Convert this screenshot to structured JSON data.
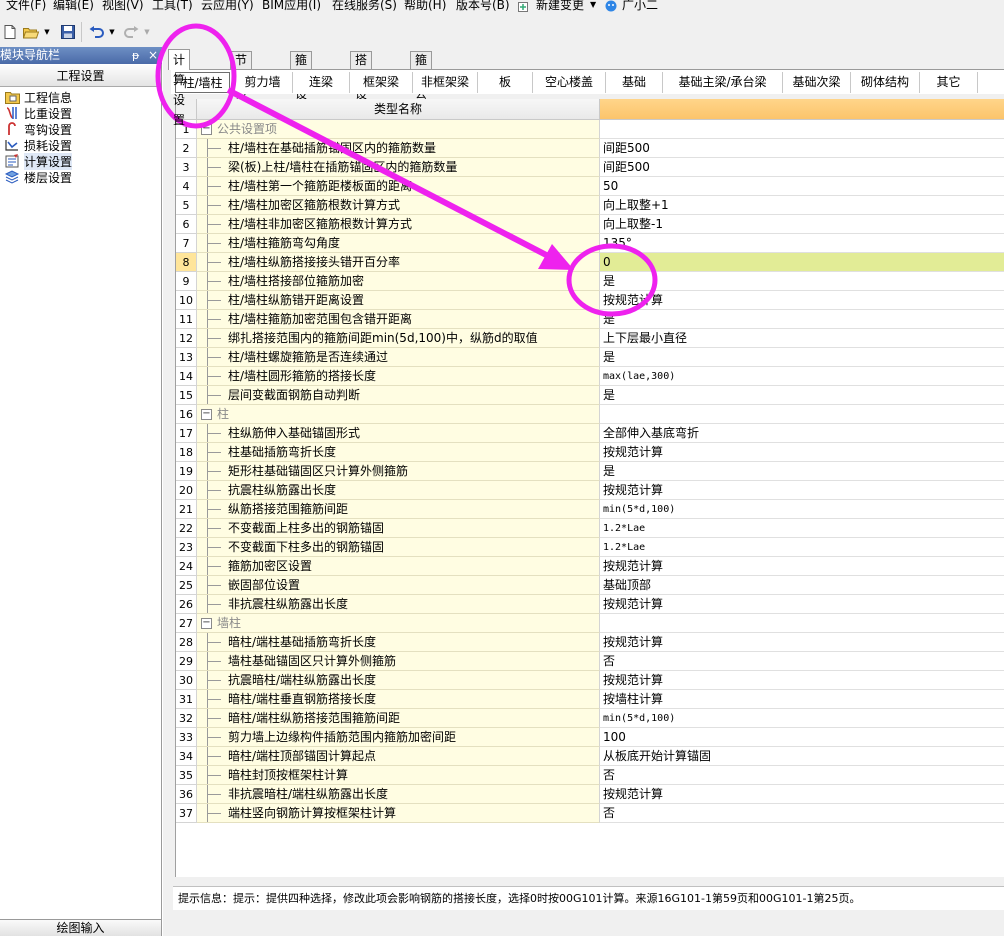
{
  "menubar": {
    "items": [
      "文件(F)",
      "编辑(E)",
      "视图(V)",
      "工具(T)",
      "云应用(Y)",
      "BIM应用(I)",
      "在线服务(S)",
      "帮助(H)",
      "版本号(B)",
      "新建变更",
      "广小二"
    ]
  },
  "toolbar": {
    "icons": [
      "new-file-icon",
      "open-folder-icon",
      "save-icon",
      "undo-icon",
      "redo-icon"
    ]
  },
  "left_panel": {
    "title": "模块导航栏",
    "pin": "ᵽ",
    "close": "×",
    "header": "工程设置",
    "items": [
      {
        "label": "工程信息",
        "icon": "project-info-icon"
      },
      {
        "label": "比重设置",
        "icon": "density-icon"
      },
      {
        "label": "弯钩设置",
        "icon": "hook-icon"
      },
      {
        "label": "损耗设置",
        "icon": "loss-icon"
      },
      {
        "label": "计算设置",
        "icon": "calc-icon"
      },
      {
        "label": "楼层设置",
        "icon": "floor-icon"
      }
    ],
    "bottom": "绘图输入"
  },
  "tabs_level1": [
    "计算设置",
    "节点设置",
    "箍筋设置",
    "搭接设置",
    "箍筋公式"
  ],
  "tabs_level2": [
    "柱/墙柱",
    "剪力墙",
    "连梁",
    "框架梁",
    "非框架梁",
    "板",
    "空心楼盖",
    "基础",
    "基础主梁/承台梁",
    "基础次梁",
    "砌体结构",
    "其它"
  ],
  "grid": {
    "header_name": "类型名称",
    "header_value": "",
    "rows": [
      {
        "n": "1",
        "name": "公共设置项",
        "value": "",
        "group": true
      },
      {
        "n": "2",
        "name": "柱/墙柱在基础插筋锚固区内的箍筋数量",
        "value": "间距500"
      },
      {
        "n": "3",
        "name": "梁(板)上柱/墙柱在插筋锚固区内的箍筋数量",
        "value": "间距500"
      },
      {
        "n": "4",
        "name": "柱/墙柱第一个箍筋距楼板面的距离",
        "value": "50"
      },
      {
        "n": "5",
        "name": "柱/墙柱加密区箍筋根数计算方式",
        "value": "向上取整+1"
      },
      {
        "n": "6",
        "name": "柱/墙柱非加密区箍筋根数计算方式",
        "value": "向上取整-1"
      },
      {
        "n": "7",
        "name": "柱/墙柱箍筋弯勾角度",
        "value": "135°"
      },
      {
        "n": "8",
        "name": "柱/墙柱纵筋搭接接头错开百分率",
        "value": "0",
        "selected": true
      },
      {
        "n": "9",
        "name": "柱/墙柱搭接部位箍筋加密",
        "value": "是"
      },
      {
        "n": "10",
        "name": "柱/墙柱纵筋错开距离设置",
        "value": "按规范计算"
      },
      {
        "n": "11",
        "name": "柱/墙柱箍筋加密范围包含错开距离",
        "value": "是"
      },
      {
        "n": "12",
        "name": "绑扎搭接范围内的箍筋间距min(5d,100)中，纵筋d的取值",
        "value": "上下层最小直径"
      },
      {
        "n": "13",
        "name": "柱/墙柱螺旋箍筋是否连续通过",
        "value": "是"
      },
      {
        "n": "14",
        "name": "柱/墙柱圆形箍筋的搭接长度",
        "value": "max(lae,300)",
        "mono": true
      },
      {
        "n": "15",
        "name": "层间变截面钢筋自动判断",
        "value": "是"
      },
      {
        "n": "16",
        "name": "柱",
        "value": "",
        "group": true
      },
      {
        "n": "17",
        "name": "柱纵筋伸入基础锚固形式",
        "value": "全部伸入基底弯折"
      },
      {
        "n": "18",
        "name": "柱基础插筋弯折长度",
        "value": "按规范计算"
      },
      {
        "n": "19",
        "name": "矩形柱基础锚固区只计算外侧箍筋",
        "value": "是"
      },
      {
        "n": "20",
        "name": "抗震柱纵筋露出长度",
        "value": "按规范计算"
      },
      {
        "n": "21",
        "name": "纵筋搭接范围箍筋间距",
        "value": "min(5*d,100)",
        "mono": true
      },
      {
        "n": "22",
        "name": "不变截面上柱多出的钢筋锚固",
        "value": "1.2*Lae",
        "mono": true
      },
      {
        "n": "23",
        "name": "不变截面下柱多出的钢筋锚固",
        "value": "1.2*Lae",
        "mono": true
      },
      {
        "n": "24",
        "name": "箍筋加密区设置",
        "value": "按规范计算"
      },
      {
        "n": "25",
        "name": "嵌固部位设置",
        "value": "基础顶部"
      },
      {
        "n": "26",
        "name": "非抗震柱纵筋露出长度",
        "value": "按规范计算"
      },
      {
        "n": "27",
        "name": "墙柱",
        "value": "",
        "group": true
      },
      {
        "n": "28",
        "name": "暗柱/端柱基础插筋弯折长度",
        "value": "按规范计算"
      },
      {
        "n": "29",
        "name": "墙柱基础锚固区只计算外侧箍筋",
        "value": "否"
      },
      {
        "n": "30",
        "name": "抗震暗柱/端柱纵筋露出长度",
        "value": "按规范计算"
      },
      {
        "n": "31",
        "name": "暗柱/端柱垂直钢筋搭接长度",
        "value": "按墙柱计算"
      },
      {
        "n": "32",
        "name": "暗柱/端柱纵筋搭接范围箍筋间距",
        "value": "min(5*d,100)",
        "mono": true
      },
      {
        "n": "33",
        "name": "剪力墙上边缘构件插筋范围内箍筋加密间距",
        "value": "100"
      },
      {
        "n": "34",
        "name": "暗柱/端柱顶部锚固计算起点",
        "value": "从板底开始计算锚固"
      },
      {
        "n": "35",
        "name": "暗柱封顶按框架柱计算",
        "value": "否"
      },
      {
        "n": "36",
        "name": "非抗震暗柱/端柱纵筋露出长度",
        "value": "按规范计算"
      },
      {
        "n": "37",
        "name": "端柱竖向钢筋计算按框架柱计算",
        "value": "否"
      }
    ]
  },
  "status": {
    "text": "提示信息：提示：提供四种选择，修改此项会影响钢筋的搭接长度，选择0时按00G101计算。来源16G101-1第59页和00G101-1第25页。"
  },
  "annotation": {
    "color": "#ee22ee"
  }
}
